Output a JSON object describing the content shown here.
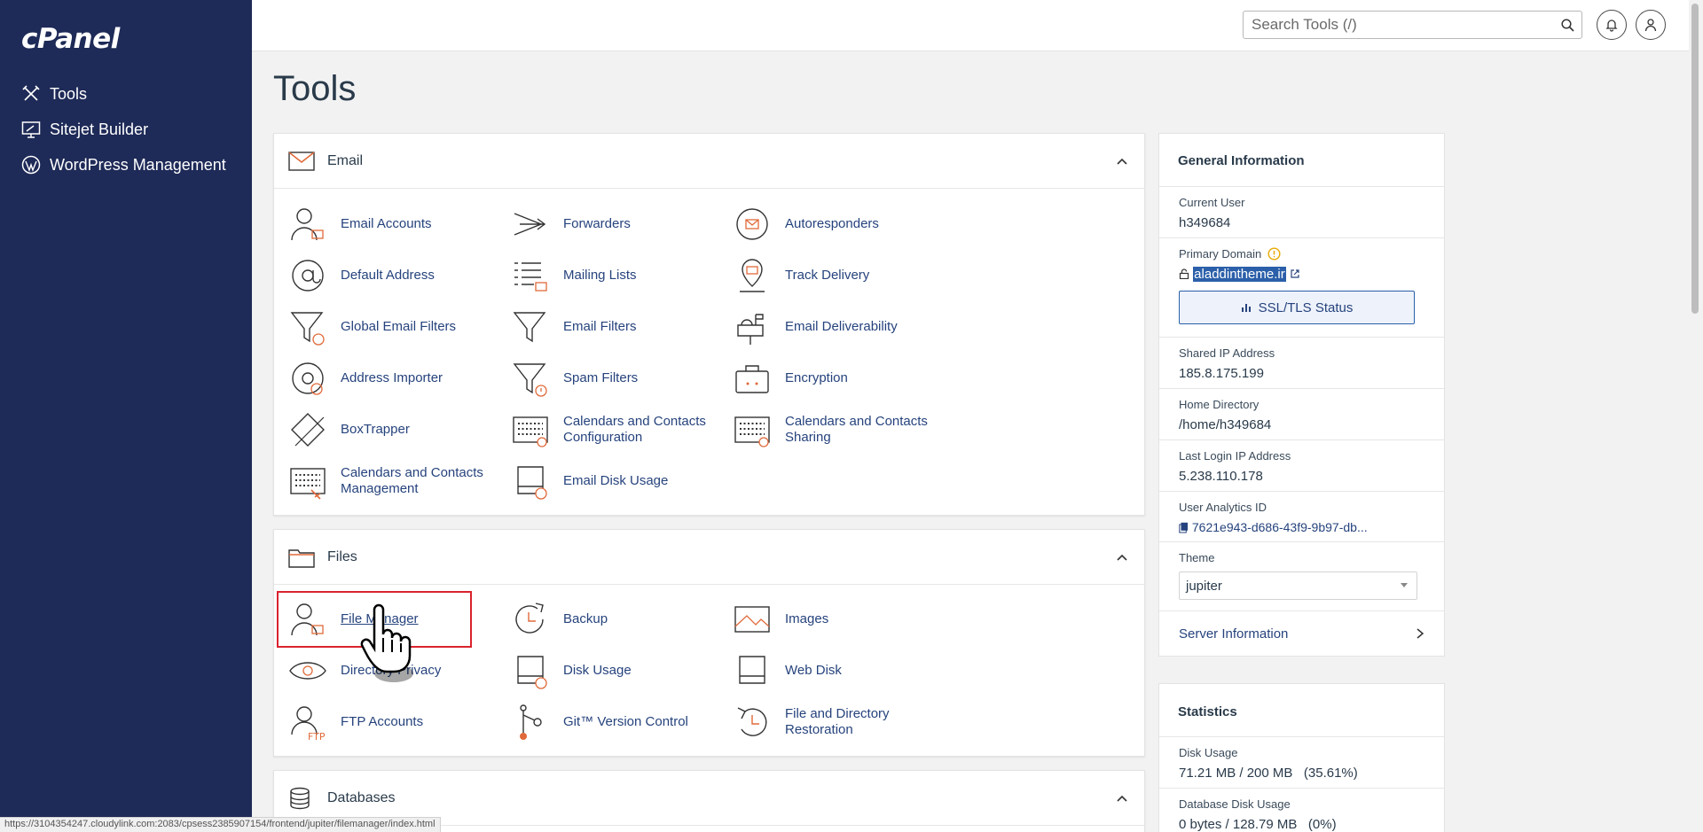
{
  "brand": {
    "logo": "cPanel"
  },
  "sidebar": {
    "items": [
      {
        "label": "Tools",
        "icon": "tools-icon"
      },
      {
        "label": "Sitejet Builder",
        "icon": "sitejet-icon"
      },
      {
        "label": "WordPress Management",
        "icon": "wordpress-icon"
      }
    ]
  },
  "header": {
    "search_placeholder": "Search Tools (/)"
  },
  "page": {
    "title": "Tools"
  },
  "sections": {
    "email": {
      "title": "Email",
      "tools": [
        "Email Accounts",
        "Forwarders",
        "Autoresponders",
        "Default Address",
        "Mailing Lists",
        "Track Delivery",
        "Global Email Filters",
        "Email Filters",
        "Email Deliverability",
        "Address Importer",
        "Spam Filters",
        "Encryption",
        "BoxTrapper",
        "Calendars and Contacts Configuration",
        "Calendars and Contacts Sharing",
        "Calendars and Contacts Management",
        "Email Disk Usage"
      ]
    },
    "files": {
      "title": "Files",
      "tools": [
        "File Manager",
        "Backup",
        "Images",
        "Directory Privacy",
        "Disk Usage",
        "Web Disk",
        "FTP Accounts",
        "Git™ Version Control",
        "File and Directory Restoration"
      ]
    },
    "databases": {
      "title": "Databases"
    }
  },
  "general_info": {
    "title": "General Information",
    "current_user_label": "Current User",
    "current_user": "h349684",
    "primary_domain_label": "Primary Domain",
    "primary_domain": "aladdintheme.ir",
    "ssl_button": "SSL/TLS Status",
    "shared_ip_label": "Shared IP Address",
    "shared_ip": "185.8.175.199",
    "home_dir_label": "Home Directory",
    "home_dir": "/home/h349684",
    "last_login_label": "Last Login IP Address",
    "last_login": "5.238.110.178",
    "analytics_label": "User Analytics ID",
    "analytics_id": "7621e943-d686-43f9-9b97-db...",
    "theme_label": "Theme",
    "theme": "jupiter",
    "server_info": "Server Information"
  },
  "statistics": {
    "title": "Statistics",
    "disk_label": "Disk Usage",
    "disk_value": "71.21 MB / 200 MB   (35.61%)",
    "db_label": "Database Disk Usage",
    "db_value": "0 bytes / 128.79 MB   (0%)"
  },
  "status_bar": {
    "url": "https://3104354247.cloudylink.com:2083/cpsess2385907154/frontend/jupiter/filemanager/index.html"
  },
  "colors": {
    "sidebar": "#1e2a57",
    "link": "#26437d",
    "accent": "#e06a3a",
    "highlight": "#d9232e"
  }
}
